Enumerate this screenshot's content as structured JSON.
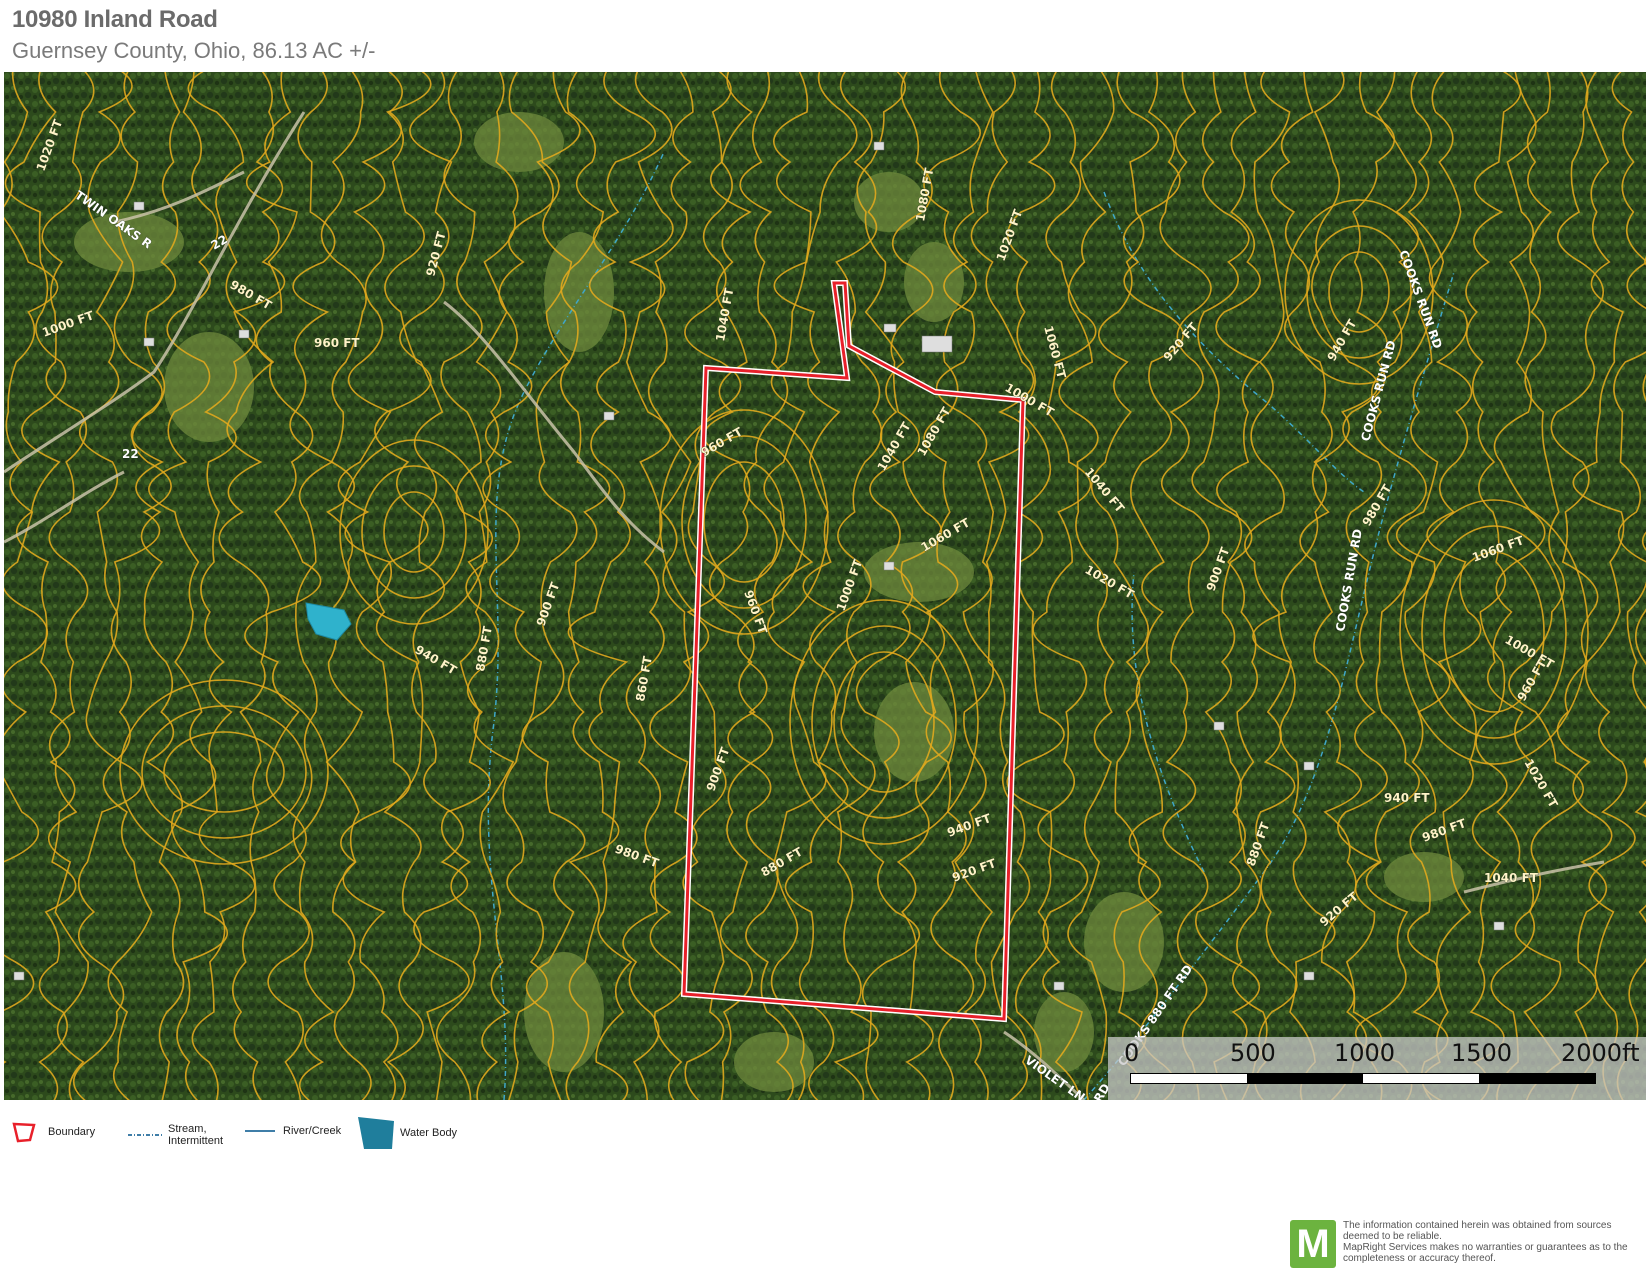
{
  "header": {
    "title": "10980 Inland Road",
    "subtitle": "Guernsey County, Ohio, 86.13 AC +/-"
  },
  "map": {
    "colors": {
      "terrain_dark": "#243d18",
      "terrain_mid": "#35561f",
      "terrain_field": "#6f8a3c",
      "contour": "#e0a81e",
      "boundary": "#e8202a",
      "stream": "#3fa7c9",
      "water_body": "#2aa6c9"
    },
    "contour_labels": [
      "1020 FT",
      "980 FT",
      "1000 FT",
      "960 FT",
      "1040 FT",
      "1060 FT",
      "1080 FT",
      "920 FT",
      "900 FT",
      "940 FT",
      "880 FT",
      "860 FT",
      "1020 FT",
      "1000 FT",
      "960 FT",
      "1040 FT",
      "1060 FT",
      "1080 FT",
      "940 FT",
      "920 FT",
      "980 FT",
      "900 FT",
      "880 FT",
      "1000 FT",
      "960 FT",
      "1020 FT",
      "1040 FT",
      "920 FT",
      "940 FT",
      "980 FT",
      "1060 FT",
      "1000 FT",
      "900 FT",
      "960 FT",
      "1020 FT",
      "940 FT",
      "980 FT",
      "1040 FT",
      "880 FT",
      "920 FT"
    ],
    "road_labels": [
      "TWIN OAKS R",
      "22",
      "22",
      "VIOLET LN",
      "COOKS RUN RD",
      "COOKS RUN RD",
      "COOKS RUN RD",
      "COOKS 880 FT RD",
      "RUN RD"
    ]
  },
  "scale_bar": {
    "ticks": [
      "0",
      "500",
      "1000",
      "1500",
      "2000ft"
    ]
  },
  "legend": [
    {
      "icon": "boundary-icon",
      "label": "Boundary"
    },
    {
      "icon": "stream-intermittent-icon",
      "label": "Stream, Intermittent"
    },
    {
      "icon": "river-creek-icon",
      "label": "River/Creek"
    },
    {
      "icon": "water-body-icon",
      "label": "Water Body"
    }
  ],
  "logo": {
    "letter": "M"
  },
  "disclaimer": "The information contained herein was obtained from sources deemed to be reliable.\n MapRight Services makes no warranties or guarantees as to the completeness or accuracy thereof."
}
